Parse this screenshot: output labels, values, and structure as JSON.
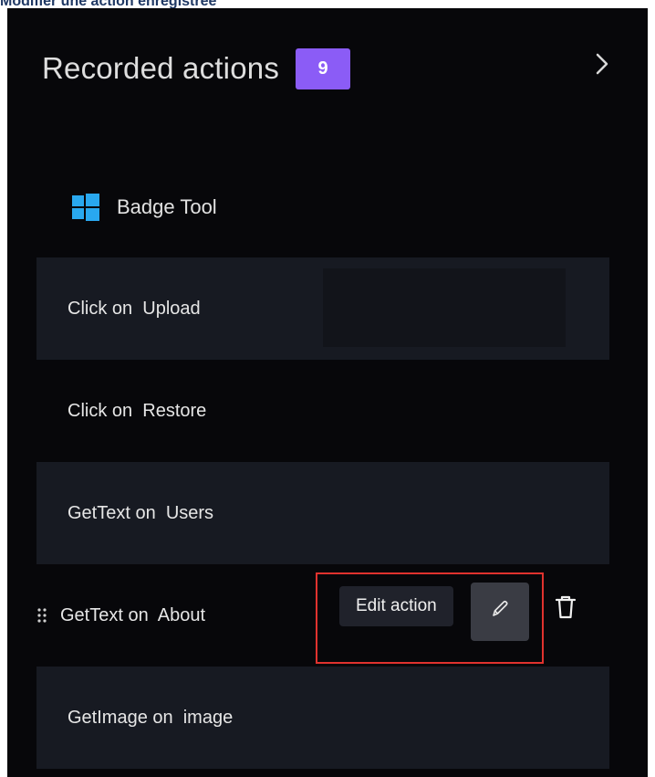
{
  "caption": "Modifier une action enregistrée",
  "panel": {
    "title": "Recorded actions",
    "count": "9",
    "badge_color": "#8b5cf6",
    "collapse_icon": "chevron-right-icon"
  },
  "app": {
    "name": "Badge Tool",
    "icon": "windows-logo-icon"
  },
  "actions": [
    {
      "text": "Click on  Upload"
    },
    {
      "text": "Click on  Restore"
    },
    {
      "text": "GetText on  Users"
    },
    {
      "text": "GetText on  About"
    },
    {
      "text": "GetImage on  image"
    }
  ],
  "hover": {
    "tooltip": "Edit action",
    "edit_icon": "pencil-icon",
    "delete_icon": "trash-icon",
    "drag_icon": "drag-handle-icon",
    "highlight_color": "#e0322e"
  }
}
